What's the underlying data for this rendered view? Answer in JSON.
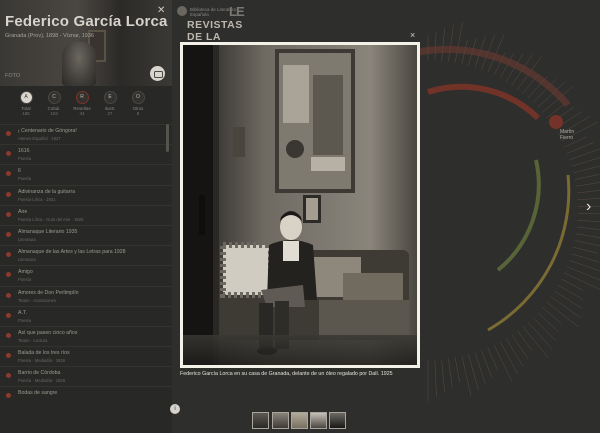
{
  "left_panel": {
    "name": "Federico García Lorca",
    "subtitle": "Granada (Prov), 1898 - Víznar, 1936",
    "photo_label": "FOTO",
    "stats": [
      {
        "icon": "A",
        "label": "Total",
        "count": "185"
      },
      {
        "icon": "C",
        "label": "Colab.",
        "count": "103"
      },
      {
        "icon": "R",
        "label": "Reseñas",
        "count": "44"
      },
      {
        "icon": "E",
        "label": "Ilustr.",
        "count": "27"
      },
      {
        "icon": "O",
        "label": "Otros",
        "count": "6"
      }
    ],
    "items": [
      {
        "title": "¡ Centenario de Góngora!",
        "sub": "Ateneo Español · 1927"
      },
      {
        "title": "1616",
        "sub": "Poesía"
      },
      {
        "title": "6",
        "sub": "Poesía"
      },
      {
        "title": "Adivinanza de la guitarra",
        "sub": "Poesía Lírica · 1921"
      },
      {
        "title": "Aire",
        "sub": "Poesía Lírica · Guía del Aire · 1926"
      },
      {
        "title": "Almanaque Literario 1935",
        "sub": "Literatura"
      },
      {
        "title": "Almanaque de las Artes y las Letras para 1928",
        "sub": "Literatura"
      },
      {
        "title": "Amigo",
        "sub": "Poesía"
      },
      {
        "title": "Amores de Don Perlimplín",
        "sub": "Teatro · Acotaciones"
      },
      {
        "title": "A.T.",
        "sub": "Poesía"
      },
      {
        "title": "Así que pasen cinco años",
        "sub": "Teatro · Lectura"
      },
      {
        "title": "Balada de los tres ríos",
        "sub": "Poesía · Mediodía · 1926"
      },
      {
        "title": "Barrio de Córdoba",
        "sub": "Poesía · Mediodía · 1926"
      },
      {
        "title": "Bodas de sangre",
        "sub": ""
      }
    ]
  },
  "header": {
    "logo_text": "Biblioteca de Literatura Española",
    "logo_mark": "LE",
    "title_line1": "REVISTAS",
    "title_line2": "DE LA"
  },
  "chart_side": {
    "label_line1": "Martín",
    "label_line2": "Fierro"
  },
  "lightbox": {
    "caption": "Federico García Lorca en su casa de Granada, delante de un óleo regalado por Dalí. 1925",
    "close_icon": "×",
    "next_icon": "›",
    "thumb_count": 6
  },
  "colors": {
    "accent": "#8a3b2d",
    "ring_red": "#7c3328",
    "ring_green": "#5d6a3a",
    "ring_yellow": "#8c7a34"
  }
}
